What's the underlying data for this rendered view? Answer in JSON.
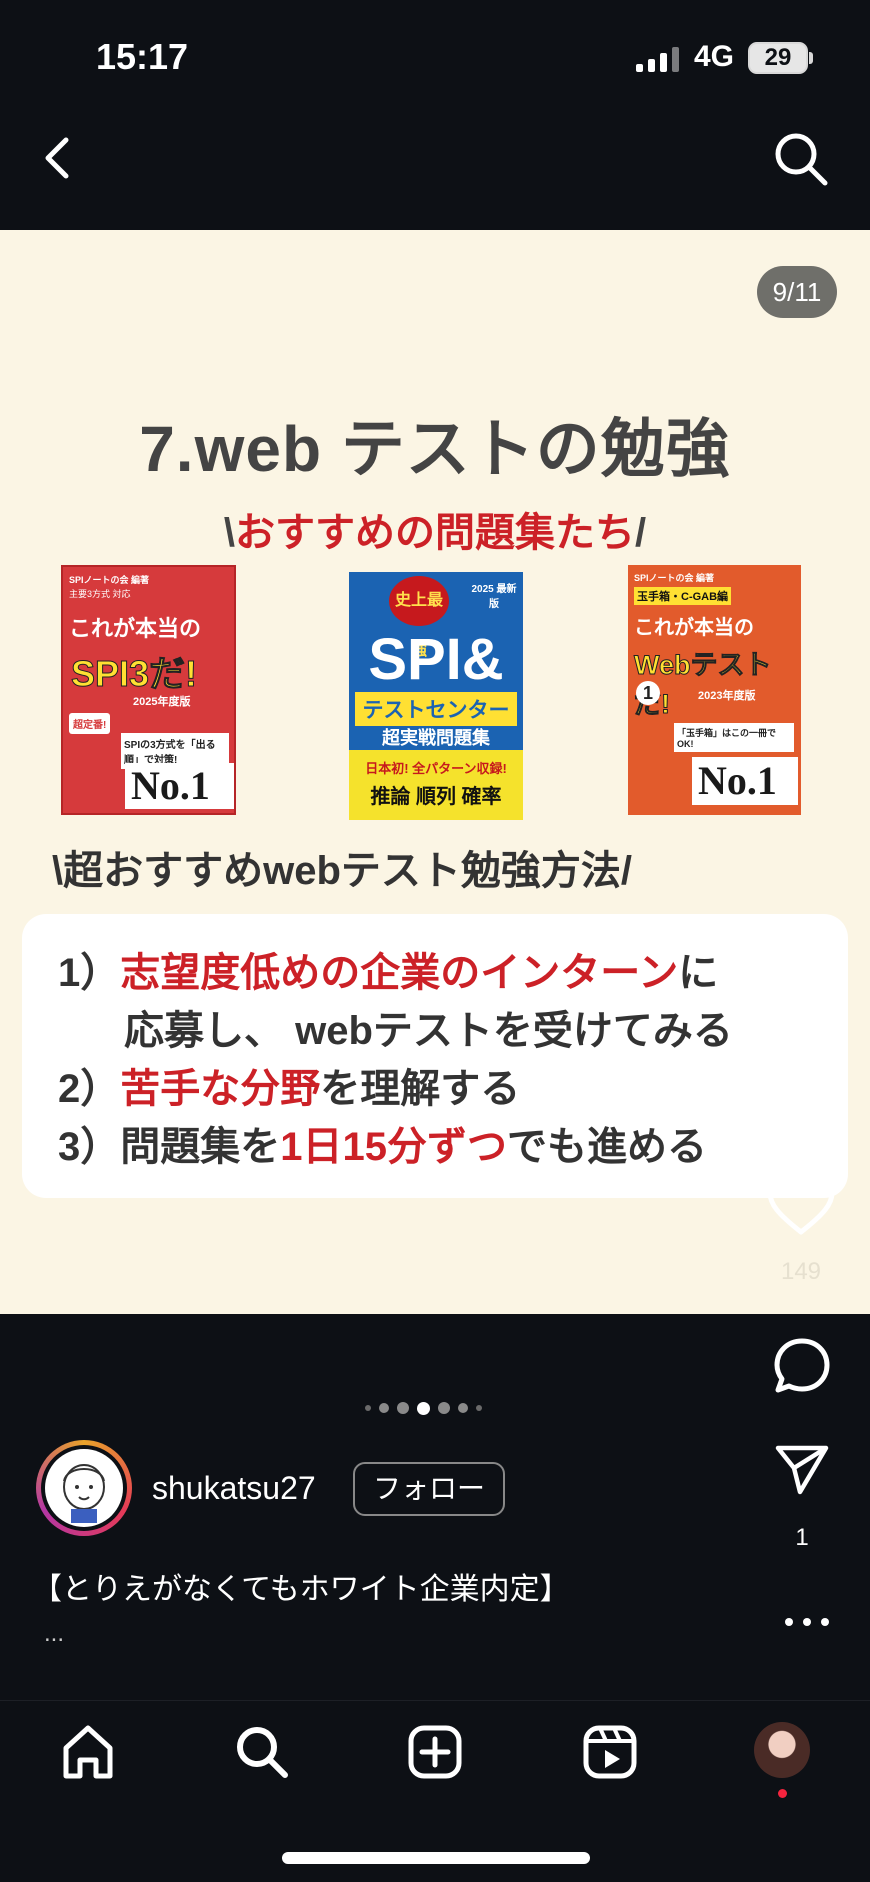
{
  "status_bar": {
    "time": "15:17",
    "network": "4G",
    "battery": "29"
  },
  "post": {
    "counter": "9/11",
    "title": "7.web テストの勉強",
    "subtitle1": {
      "left": "\\",
      "text": "おすすめの問題集たち",
      "right": "/"
    },
    "books": [
      {
        "top": "SPIノートの会 編著",
        "line2": "主要3方式 対応",
        "main": "これが本当の",
        "big": "SPI3だ!",
        "year": "2025年度版",
        "badge": "超定番!",
        "note": "SPIの3方式を「出る順」で対策!",
        "rank": "No.1"
      },
      {
        "top": "史上最強",
        "year": "2025 最新版",
        "big": "SPI&",
        "band": "テストセンター",
        "sub": "超実戦問題集",
        "red": "日本初! 全パターン収録!",
        "words": "推論 順列 確率"
      },
      {
        "top": "SPIノートの会 編著",
        "line2": "玉手箱・C-GAB編",
        "main": "これが本当の",
        "big": "Webテストだ!",
        "num": "1",
        "year": "2023年度版",
        "note": "「玉手箱」はこの一冊でOK!",
        "rank": "No.1"
      }
    ],
    "subtitle2": {
      "left": "\\",
      "text": "超おすすめwebテスト勉強方法",
      "right": "/"
    },
    "methods": [
      {
        "num": "1）",
        "red": "志望度低めの企業のインターン",
        "rest": "に"
      },
      {
        "cont": "応募し、 webテストを受けてみる"
      },
      {
        "num": "2）",
        "red": "苦手な分野",
        "rest": "を理解する"
      },
      {
        "num": "3）",
        "pre": "問題集を",
        "red": "1日15分ずつ",
        "rest": "でも進める"
      }
    ]
  },
  "actions": {
    "like_count": "149",
    "share_count": "1"
  },
  "pagination": {
    "total": 7,
    "active": 4
  },
  "user": {
    "username": "shukatsu27",
    "follow_label": "フォロー"
  },
  "caption": {
    "text": "【とりえがなくてもホワイト企業内定】",
    "more": "..."
  },
  "icons": {
    "back": "chevron-left-icon",
    "search": "search-icon",
    "like": "heart-icon",
    "comment": "comment-icon",
    "share": "send-icon",
    "more": "more-icon",
    "home": "home-icon",
    "add": "add-icon",
    "reels": "reels-icon"
  },
  "colors": {
    "background": "#0d1015",
    "post_bg": "#fbf5e4",
    "accent_red": "#cc2127",
    "title_gray": "#444444"
  }
}
